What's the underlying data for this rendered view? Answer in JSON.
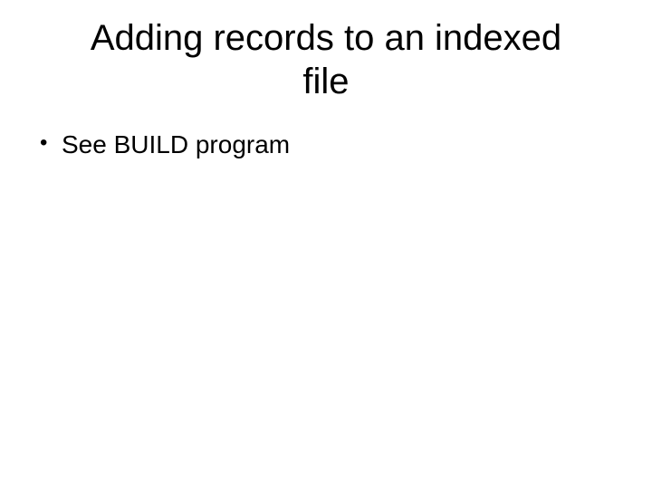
{
  "slide": {
    "title": "Adding records to an indexed file",
    "bullets": [
      {
        "text": "See BUILD program"
      }
    ]
  }
}
